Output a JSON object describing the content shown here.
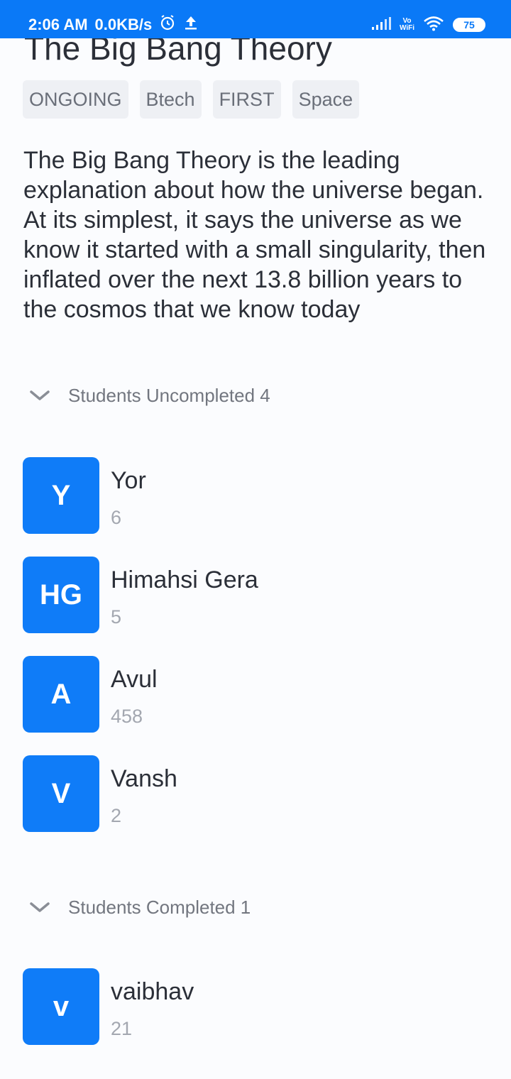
{
  "status_bar": {
    "time": "2:06 AM",
    "network_speed": "0.0KB/s",
    "vowifi_top": "Vo",
    "vowifi_bottom": "WiFi",
    "battery": "75"
  },
  "title": "The Big Bang Theory",
  "tags": [
    "ONGOING",
    "Btech",
    "FIRST",
    "Space"
  ],
  "description": "The Big Bang Theory is the leading explanation about how the universe began. At its simplest, it says the universe as we know it started with a small singularity, then inflated over the next 13.8 billion years to the cosmos that we know today",
  "sections": [
    {
      "label": "Students Uncompleted 4",
      "icon": "chevron-down-icon",
      "students": [
        {
          "initials": "Y",
          "name": "Yor",
          "count": "6"
        },
        {
          "initials": "HG",
          "name": "Himahsi Gera",
          "count": "5"
        },
        {
          "initials": "A",
          "name": "Avul",
          "count": "458"
        },
        {
          "initials": "V",
          "name": "Vansh",
          "count": "2"
        }
      ]
    },
    {
      "label": "Students Completed 1",
      "icon": "chevron-down-icon",
      "students": [
        {
          "initials": "v",
          "name": "vaibhav",
          "count": "21"
        }
      ]
    }
  ],
  "colors": {
    "accent": "#0a79f7",
    "avatar": "#0f7cf8",
    "tag_bg": "#eef0f4"
  }
}
